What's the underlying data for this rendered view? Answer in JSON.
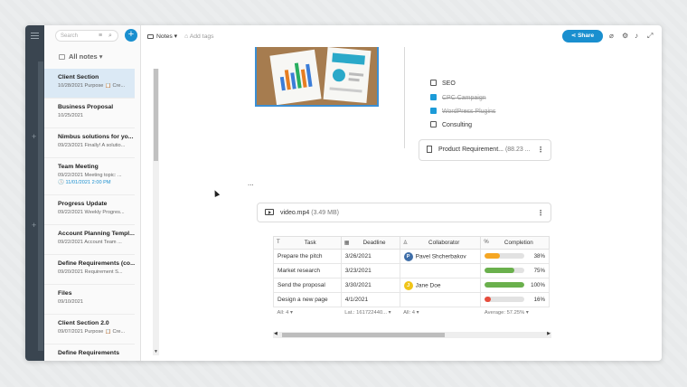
{
  "search": {
    "placeholder": "Search"
  },
  "list": {
    "header": "All notes",
    "items": [
      {
        "title": "Client Section",
        "sub": "10/28/2021 Purpose 📋 Cre..."
      },
      {
        "title": "Business Proposal",
        "sub": "10/25/2021"
      },
      {
        "title": "Nimbus solutions for yo...",
        "sub": "09/23/2021 Finally! A solutio..."
      },
      {
        "title": "Team Meeting",
        "sub": "09/22/2021 Meeting topic: ...",
        "reminder": "11/01/2021 2:00 PM"
      },
      {
        "title": "Progress Update",
        "sub": "09/22/2021 Weekly Progres..."
      },
      {
        "title": "Account Planning Templ...",
        "sub": "09/22/2021 Account Team ..."
      },
      {
        "title": "Define Requirements (co...",
        "sub": "09/20/2021 Requirement S..."
      },
      {
        "title": "Files",
        "sub": "09/10/2021"
      },
      {
        "title": "Client Section 2.0",
        "sub": "09/07/2021 Purpose 📋 Cre..."
      },
      {
        "title": "Define Requirements",
        "sub": ""
      }
    ]
  },
  "topbar": {
    "folder": "Notes",
    "tags": "Add tags",
    "share": "Share"
  },
  "checklist": [
    {
      "label": "SEO",
      "done": false
    },
    {
      "label": "CPC Campaign",
      "done": true
    },
    {
      "label": "WordPress Plugins",
      "done": true
    },
    {
      "label": "Consulting",
      "done": false
    }
  ],
  "attachment": {
    "name": "Product Requirement...",
    "size": "(88.23 ..."
  },
  "ellipsis": "...",
  "video": {
    "name": "video.mp4",
    "size": "(3.49 MB)"
  },
  "table": {
    "headers": [
      "Task",
      "Deadline",
      "Collaborator",
      "Completion"
    ],
    "rows": [
      {
        "task": "Prepare the pitch",
        "deadline": "3/26/2021",
        "collab": "Pavel Shcherbakov",
        "initial": "P",
        "avatar_color": "#3f6ea8",
        "pct": "38%",
        "fill": 38,
        "color": "#f5a623"
      },
      {
        "task": "Market research",
        "deadline": "3/23/2021",
        "collab": "",
        "initial": "",
        "avatar_color": "",
        "pct": "75%",
        "fill": 75,
        "color": "#6ab04c"
      },
      {
        "task": "Send the proposal",
        "deadline": "3/30/2021",
        "collab": "Jane Doe",
        "initial": "J",
        "avatar_color": "#f0c419",
        "pct": "100%",
        "fill": 100,
        "color": "#6ab04c"
      },
      {
        "task": "Design a new page",
        "deadline": "4/1/2021",
        "collab": "",
        "initial": "",
        "avatar_color": "",
        "pct": "16%",
        "fill": 16,
        "color": "#e74c3c"
      }
    ],
    "footer": [
      "All: 4",
      "Lat.: 161722440...",
      "All: 4",
      "Average: 57.25%"
    ]
  }
}
